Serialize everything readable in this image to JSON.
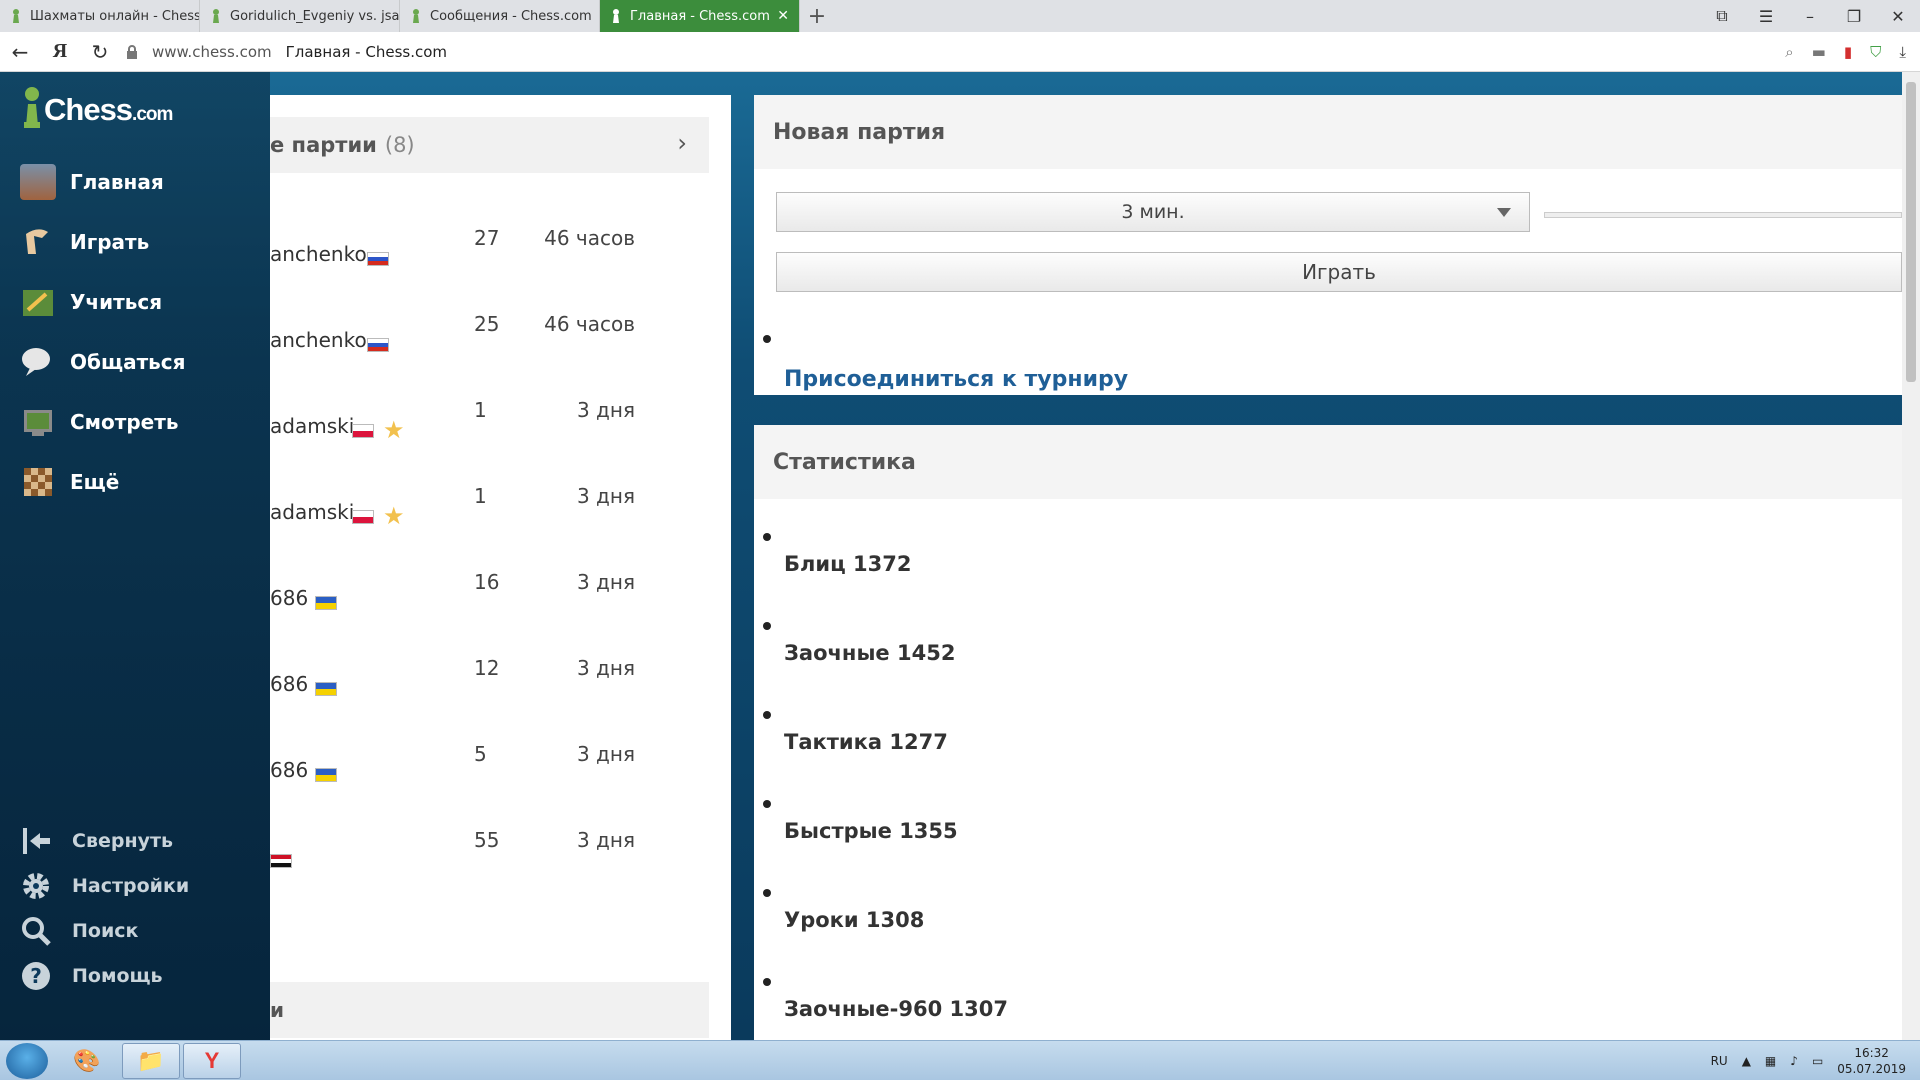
{
  "browser": {
    "tabs": [
      {
        "label": "Шахматы онлайн - Chess.c",
        "active": false
      },
      {
        "label": "Goridulich_Evgeniy vs. jsalm",
        "active": false
      },
      {
        "label": "Сообщения - Chess.com",
        "active": false
      },
      {
        "label": "Главная - Chess.com",
        "active": true
      }
    ],
    "new_tab_label": "+",
    "close_tab_label": "✕",
    "address": {
      "domain": "www.chess.com",
      "page_title": "Главная - Chess.com"
    }
  },
  "sidebar": {
    "brand": "Chess",
    "brand_suffix": ".com",
    "items": [
      {
        "label": "Главная",
        "icon": "home-icon"
      },
      {
        "label": "Играть",
        "icon": "play-icon"
      },
      {
        "label": "Учиться",
        "icon": "learn-icon"
      },
      {
        "label": "Общаться",
        "icon": "chat-icon"
      },
      {
        "label": "Смотреть",
        "icon": "watch-icon"
      },
      {
        "label": "Ещё",
        "icon": "more-icon"
      }
    ],
    "bottom_items": [
      {
        "label": "Свернуть",
        "icon": "collapse-icon"
      },
      {
        "label": "Настройки",
        "icon": "gear-icon"
      },
      {
        "label": "Поиск",
        "icon": "search-icon"
      },
      {
        "label": "Помощь",
        "icon": "help-icon"
      }
    ]
  },
  "games": {
    "title": "е партии",
    "count": "(8)",
    "rows": [
      {
        "name": "anchenko",
        "flag": "ru",
        "star": false,
        "moves": "27",
        "time": "46 часов"
      },
      {
        "name": "anchenko",
        "flag": "ru",
        "star": false,
        "moves": "25",
        "time": "46 часов"
      },
      {
        "name": "adamski",
        "flag": "pl",
        "star": true,
        "moves": "1",
        "time": "3 дня"
      },
      {
        "name": "adamski",
        "flag": "pl",
        "star": true,
        "moves": "1",
        "time": "3 дня"
      },
      {
        "name": "686",
        "flag": "ua",
        "star": false,
        "moves": "16",
        "time": "3 дня"
      },
      {
        "name": "686",
        "flag": "ua",
        "star": false,
        "moves": "12",
        "time": "3 дня"
      },
      {
        "name": "686",
        "flag": "ua",
        "star": false,
        "moves": "5",
        "time": "3 дня"
      },
      {
        "name": "",
        "flag": "eg",
        "star": false,
        "moves": "55",
        "time": "3 дня"
      }
    ],
    "footer_label": "и"
  },
  "new_game": {
    "title": "Новая партия",
    "time_control": "3 мин.",
    "play_button": "Играть",
    "tournament_link": "Присоединиться к турниру"
  },
  "stats": {
    "title": "Статистика",
    "items": [
      "Блиц 1372",
      "Заочные 1452",
      "Тактика 1277",
      "Быстрые 1355",
      "Уроки 1308",
      "Заочные-960 1307"
    ]
  },
  "taskbar": {
    "lang": "RU",
    "time": "16:32",
    "date": "05.07.2019"
  },
  "colors": {
    "active_tab": "#3c8d3c",
    "page_bg": "#0f4d74",
    "link": "#1f5f97",
    "star": "#f2c14e"
  }
}
